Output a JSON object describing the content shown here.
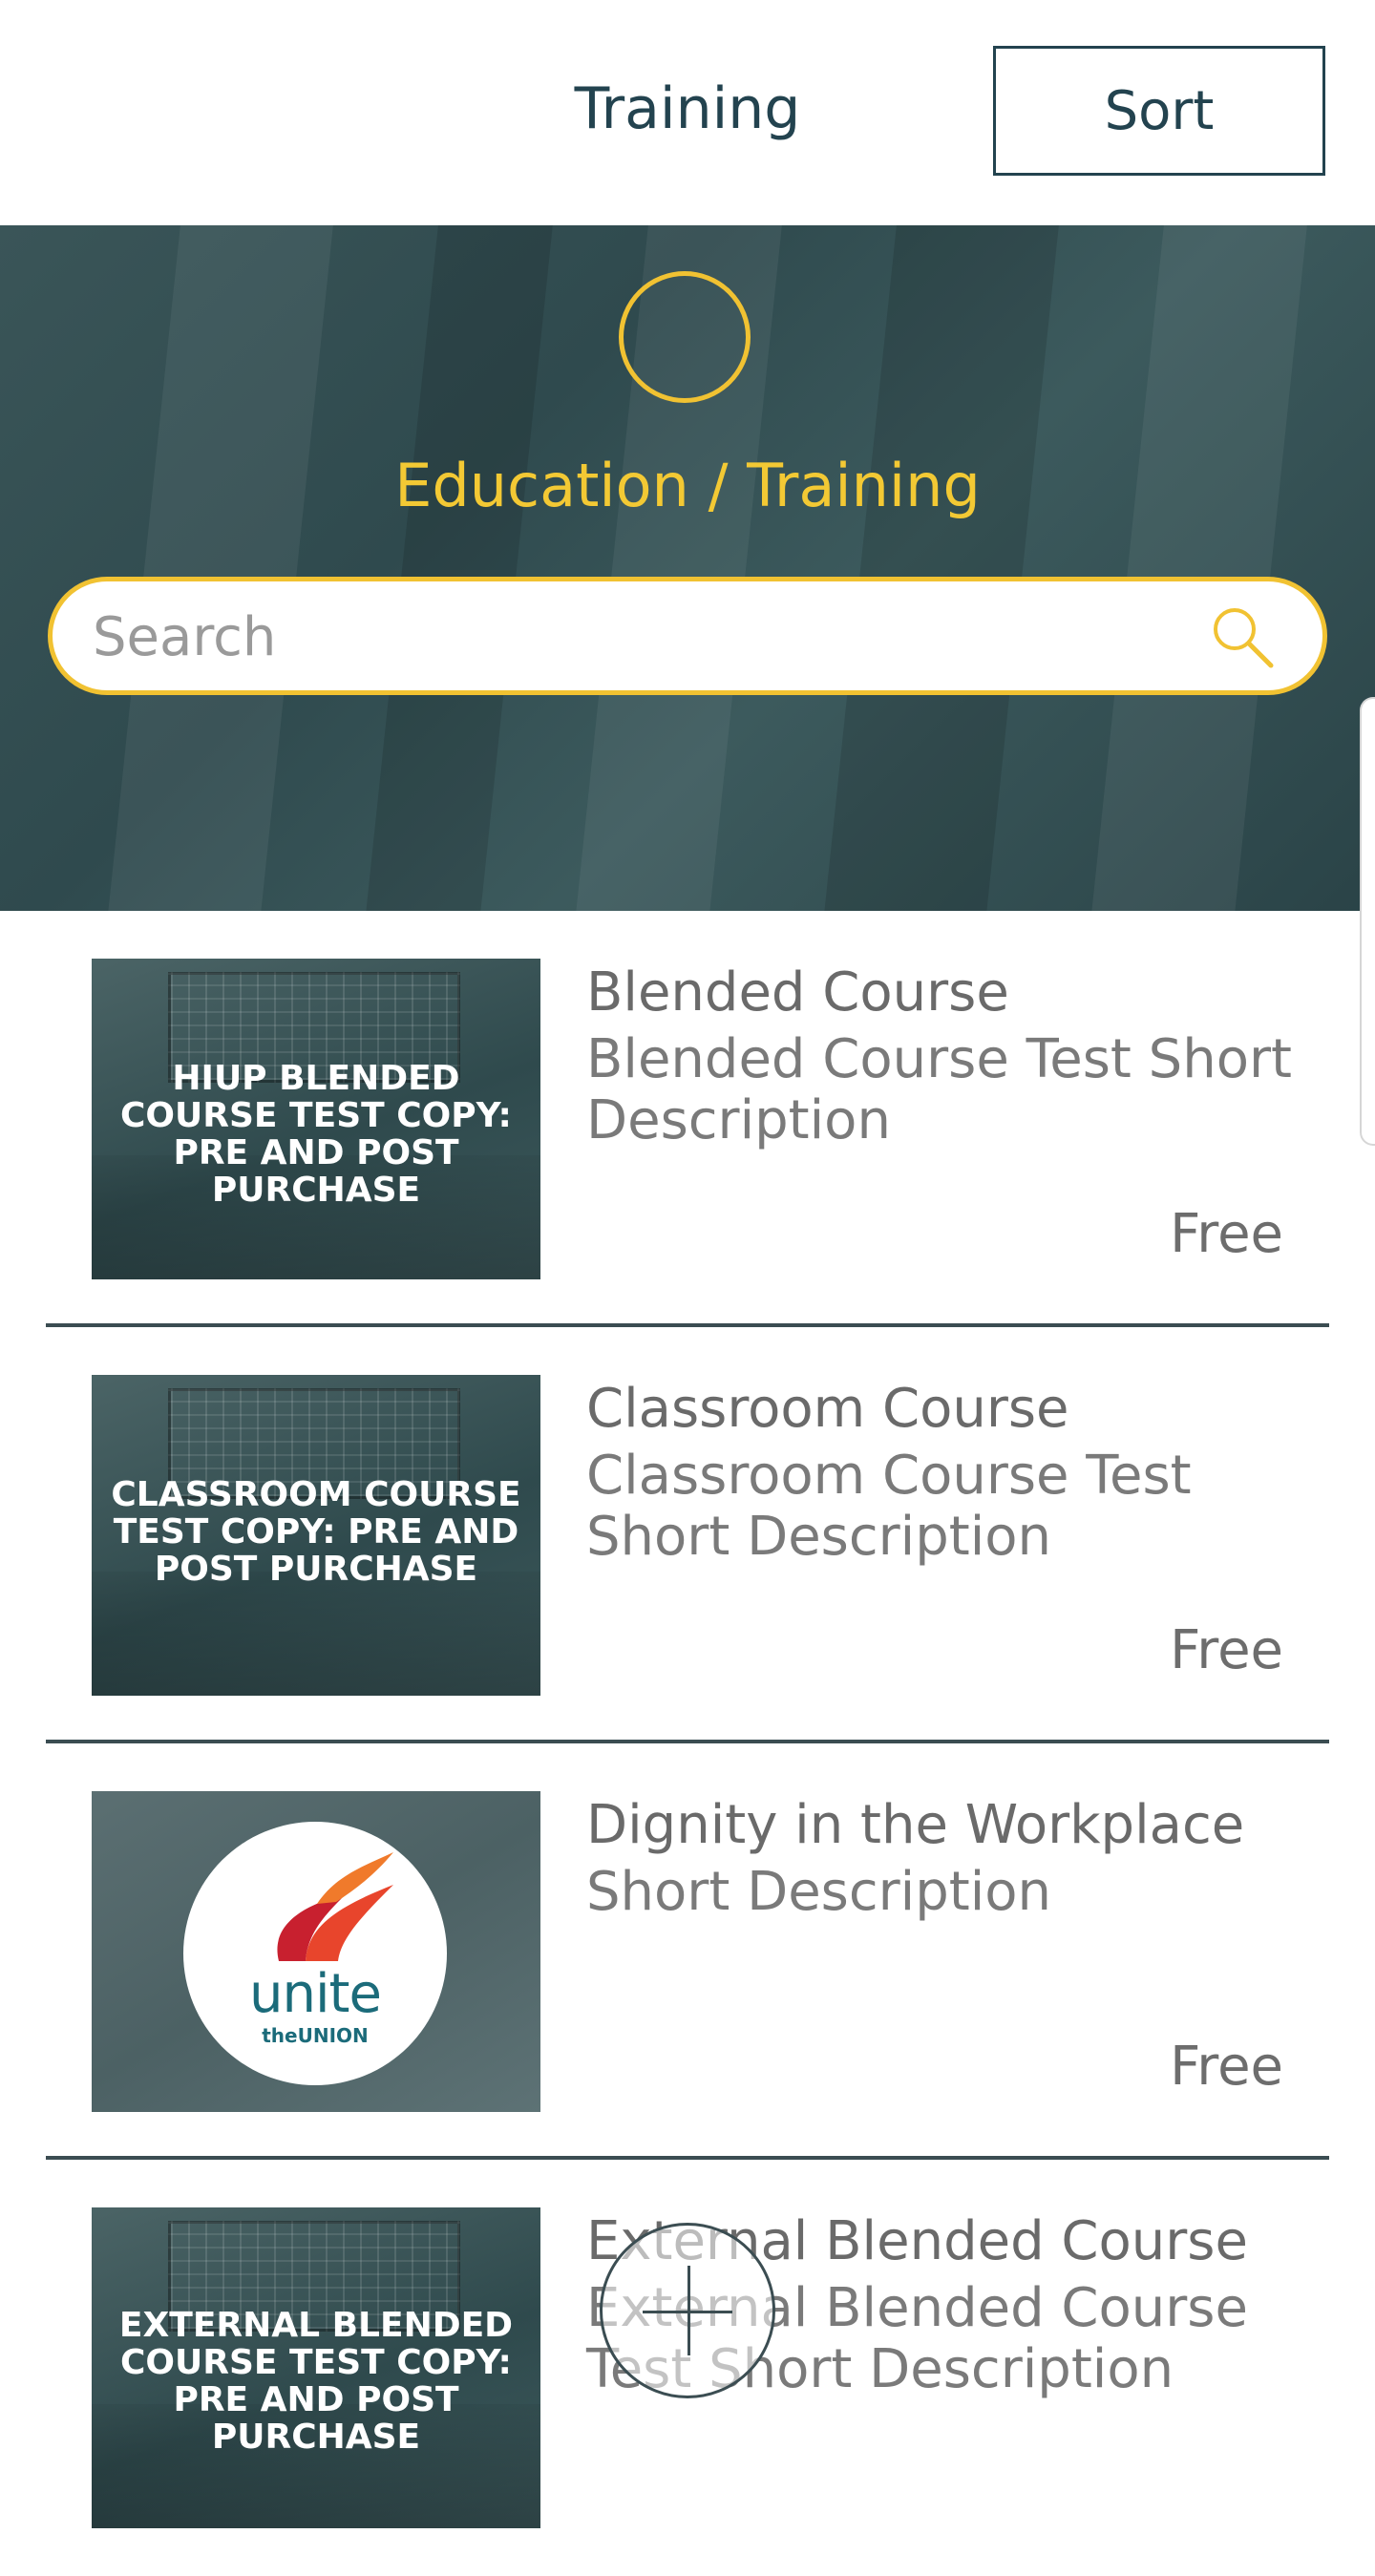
{
  "header": {
    "title": "Training",
    "sort_label": "Sort"
  },
  "hero": {
    "subtitle": "Education / Training"
  },
  "search": {
    "placeholder": "Search",
    "value": ""
  },
  "courses": [
    {
      "title": "Blended Course",
      "description": "Blended Course Test Short Description",
      "price": "Free",
      "thumbnail_text": "HIUP BLENDED COURSE TEST COPY: PRE AND POST PURCHASE"
    },
    {
      "title": "Classroom Course",
      "description": "Classroom Course Test Short Description",
      "price": "Free",
      "thumbnail_text": "CLASSROOM COURSE TEST COPY: PRE AND POST PURCHASE"
    },
    {
      "title": "Dignity in the Workplace",
      "description": "Short Description",
      "price": "Free",
      "thumbnail_logo": {
        "word": "unite",
        "union": "theUNION"
      }
    },
    {
      "title": "External Blended Course",
      "description": "External Blended Course Test Short Description",
      "thumbnail_text": "EXTERNAL BLENDED COURSE TEST COPY: PRE AND POST PURCHASE"
    }
  ],
  "colors": {
    "accent": "#f1c232",
    "dark": "#23434f",
    "hero": "#2f4a4e",
    "text": "#6d6d6d"
  },
  "icons": {
    "search": "search-icon",
    "add": "plus-icon"
  }
}
